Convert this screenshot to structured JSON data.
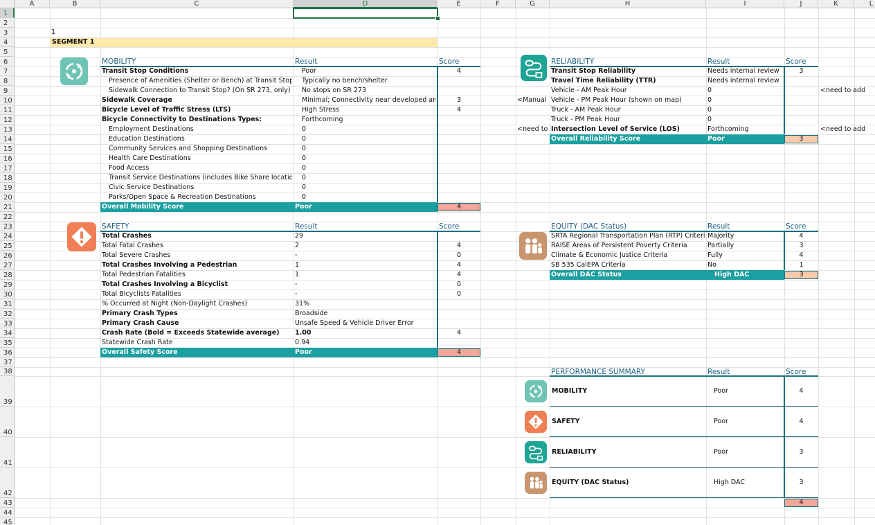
{
  "columns": [
    "A",
    "B",
    "C",
    "D",
    "E",
    "F",
    "G",
    "H",
    "I",
    "J",
    "K",
    "L"
  ],
  "rows": [
    "1",
    "2",
    "3",
    "4",
    "5",
    "6",
    "7",
    "8",
    "9",
    "10",
    "11",
    "12",
    "13",
    "14",
    "15",
    "16",
    "17",
    "18",
    "19",
    "20",
    "21",
    "22",
    "23",
    "24",
    "25",
    "26",
    "27",
    "28",
    "29",
    "30",
    "31",
    "32",
    "33",
    "34",
    "35",
    "36",
    "37",
    "38",
    "39",
    "40",
    "41",
    "42",
    "43",
    "44",
    "45"
  ],
  "selected_cell": "D1",
  "b3": "1",
  "segment_label": "SEGMENT 1",
  "colors": {
    "teal": "#1c9fa0",
    "mobility_icon": "#6fc4b5",
    "safety_icon": "#f07f55",
    "reliability_icon": "#1da494",
    "equity_icon": "#c9956e",
    "score_red": "#f3a79a",
    "score_peach": "#f8cbad",
    "segment_yellow": "#fde9a9"
  },
  "mobility": {
    "icon": "mobility-cycle-icon",
    "title": "MOBILITY",
    "result_header": "Result",
    "score_header": "Score",
    "rows": [
      {
        "label": "Transit Stop Conditions",
        "result": "Poor",
        "score": "4",
        "bold": true,
        "indent": false
      },
      {
        "label": "Presence of Amenities (Shelter or Bench) at Transit Stop?",
        "result": "Typically no bench/shelter",
        "score": "",
        "bold": false,
        "indent": true
      },
      {
        "label": "Sidewalk Connection to Transit Stop? (On SR 273, only)",
        "result": "No stops on SR 273",
        "score": "",
        "bold": false,
        "indent": true
      },
      {
        "label": "Sidewalk Coverage",
        "result": "Minimal; Connectivity near developed areas",
        "score": "3",
        "bold": true,
        "indent": false
      },
      {
        "label": "Bicycle Level of Traffic Stress (LTS)",
        "result": "High Stress",
        "score": "4",
        "bold": true,
        "indent": false
      },
      {
        "label": "Bicycle Connectivity to Destinations Types:",
        "result": "Forthcoming",
        "score": "",
        "bold": true,
        "indent": false
      },
      {
        "label": "Employment Destinations",
        "result": "0",
        "score": "",
        "bold": false,
        "indent": true
      },
      {
        "label": "Education Destinations",
        "result": "0",
        "score": "",
        "bold": false,
        "indent": true
      },
      {
        "label": "Community Services and Shopping Destinations",
        "result": "0",
        "score": "",
        "bold": false,
        "indent": true
      },
      {
        "label": "Health Care Destinations",
        "result": "0",
        "score": "",
        "bold": false,
        "indent": true
      },
      {
        "label": "Food Access",
        "result": "0",
        "score": "",
        "bold": false,
        "indent": true
      },
      {
        "label": "Transit Service Destinations (includes Bike Share locations)",
        "result": "0",
        "score": "",
        "bold": false,
        "indent": true
      },
      {
        "label": "Civic Service Destinations",
        "result": "0",
        "score": "",
        "bold": false,
        "indent": true
      },
      {
        "label": "Parks/Open Space & Recreation Destinations",
        "result": "0",
        "score": "",
        "bold": false,
        "indent": true
      }
    ],
    "overall_label": "Overall Mobility Score",
    "overall_result": "Poor",
    "overall_score": "4"
  },
  "safety": {
    "icon": "safety-alert-icon",
    "title": "SAFETY",
    "result_header": "Result",
    "score_header": "Score",
    "rows": [
      {
        "label": "Total Crashes",
        "result": "29",
        "score": "",
        "bold": true
      },
      {
        "label": "Total Fatal Crashes",
        "result": "2",
        "score": "4",
        "bold": false
      },
      {
        "label": "Total Severe Crashes",
        "result": "-",
        "score": "0",
        "bold": false
      },
      {
        "label": "Total Crashes Involving a Pedestrian",
        "result": "1",
        "score": "4",
        "bold": true
      },
      {
        "label": "Total Pedestrian Fatalities",
        "result": "1",
        "score": "4",
        "bold": false
      },
      {
        "label": "Total Crashes Involving a Bicyclist",
        "result": "-",
        "score": "0",
        "bold": true
      },
      {
        "label": "Total Bicyclists Fatalities",
        "result": "-",
        "score": "0",
        "bold": false
      },
      {
        "label": "% Occurred at Night (Non-Daylight Crashes)",
        "result": "31%",
        "score": "",
        "bold": false
      },
      {
        "label": "Primary Crash Types",
        "result": "Broadside",
        "score": "",
        "bold": true
      },
      {
        "label": "Primary Crash Cause",
        "result": "Unsafe Speed & Vehicle Driver Error",
        "score": "",
        "bold": true
      },
      {
        "label": "Crash Rate (Bold = Exceeds Statewide average)",
        "result": "1.00",
        "score": "4",
        "bold": true,
        "result_bold": true
      },
      {
        "label": "Statewide Crash Rate",
        "result": "0.94",
        "score": "",
        "bold": false
      }
    ],
    "overall_label": "Overall Safety Score",
    "overall_result": "Poor",
    "overall_score": "4"
  },
  "reliability": {
    "icon": "reliability-route-icon",
    "title": "RELIABILITY",
    "result_header": "Result",
    "score_header": "Score",
    "rows": [
      {
        "label": "Transit Stop Reliability",
        "result": "Needs internal review",
        "score": "3",
        "bold": true,
        "note_left": "",
        "note_right": ""
      },
      {
        "label": "Travel Time Reliability (TTR)",
        "result": "Needs internal review",
        "score": "",
        "bold": true,
        "note_left": "",
        "note_right": ""
      },
      {
        "label": "Vehicle - AM Peak Hour",
        "result": "0",
        "score": "",
        "bold": false,
        "note_left": "",
        "note_right": "<need to add"
      },
      {
        "label": "Vehicle - PM Peak Hour (shown on map)",
        "result": "0",
        "score": "",
        "bold": false,
        "note_left": "<Manual",
        "note_right": ""
      },
      {
        "label": "Truck - AM Peak Hour",
        "result": "0",
        "score": "",
        "bold": false,
        "note_left": "",
        "note_right": ""
      },
      {
        "label": "Truck - PM Peak Hour",
        "result": "0",
        "score": "",
        "bold": false,
        "note_left": "",
        "note_right": ""
      },
      {
        "label": "Intersection Level of Service (LOS)",
        "result": "Forthcoming",
        "score": "",
        "bold": true,
        "note_left": "<need to a",
        "note_right": "<need to add"
      }
    ],
    "overall_label": "Overall Reliability Score",
    "overall_result": "Poor",
    "overall_score": "3"
  },
  "equity": {
    "icon": "equity-family-icon",
    "title": "EQUITY (DAC Status)",
    "result_header": "Result",
    "score_header": "Score",
    "rows": [
      {
        "label": "SRTA Regional Transportation Plan (RTP) Criteria",
        "result": "Majority",
        "score": "4"
      },
      {
        "label": "RAISE Areas of Persistent Poverty Criteria",
        "result": "Partially",
        "score": "3"
      },
      {
        "label": "Climate & Economic Justice Criteria",
        "result": "Fully",
        "score": "4"
      },
      {
        "label": "SB 535 CalEPA Criteria",
        "result": "No",
        "score": "1"
      }
    ],
    "overall_label": "Overall DAC Status",
    "overall_result": "High DAC",
    "overall_score": "3"
  },
  "summary": {
    "title": "PERFORMANCE SUMMARY",
    "result_header": "Result",
    "score_header": "Score",
    "rows": [
      {
        "label": "MOBILITY",
        "result": "Poor",
        "score": "4",
        "icon": "mobility-cycle-icon"
      },
      {
        "label": "SAFETY",
        "result": "Poor",
        "score": "4",
        "icon": "safety-alert-icon"
      },
      {
        "label": "RELIABILITY",
        "result": "Poor",
        "score": "3",
        "icon": "reliability-route-icon"
      },
      {
        "label": "EQUITY (DAC Status)",
        "result": "High DAC",
        "score": "3",
        "icon": "equity-family-icon"
      }
    ],
    "total_score": "4"
  }
}
